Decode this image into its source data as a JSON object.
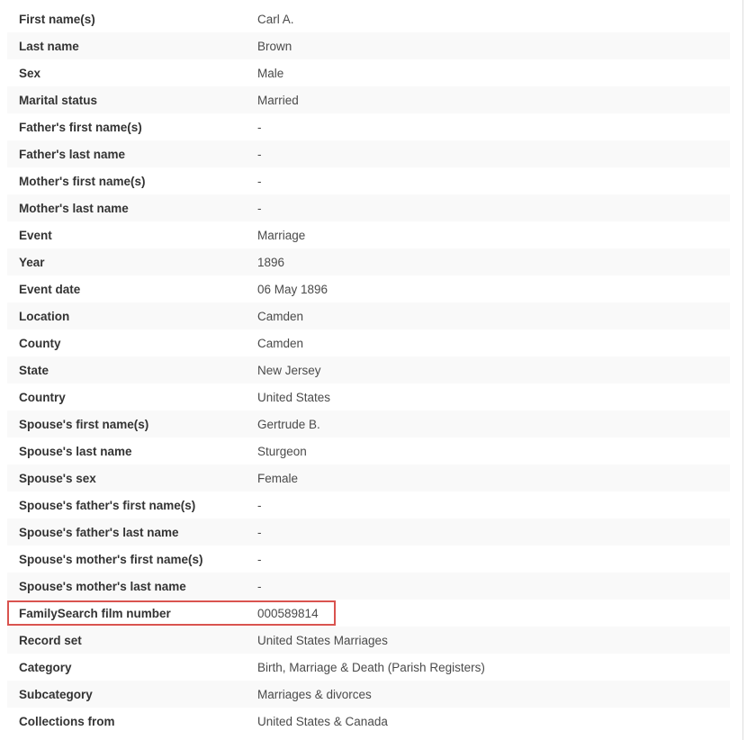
{
  "highlight_color": "#d9534f",
  "highlighted_field": "familysearch_film_number",
  "rows": [
    {
      "label": "First name(s)",
      "value": "Carl A."
    },
    {
      "label": "Last name",
      "value": "Brown"
    },
    {
      "label": "Sex",
      "value": "Male"
    },
    {
      "label": "Marital status",
      "value": "Married"
    },
    {
      "label": "Father's first name(s)",
      "value": "-"
    },
    {
      "label": "Father's last name",
      "value": "-"
    },
    {
      "label": "Mother's first name(s)",
      "value": "-"
    },
    {
      "label": "Mother's last name",
      "value": "-"
    },
    {
      "label": "Event",
      "value": "Marriage"
    },
    {
      "label": "Year",
      "value": "1896"
    },
    {
      "label": "Event date",
      "value": "06 May 1896"
    },
    {
      "label": "Location",
      "value": "Camden"
    },
    {
      "label": "County",
      "value": "Camden"
    },
    {
      "label": "State",
      "value": "New Jersey"
    },
    {
      "label": "Country",
      "value": "United States"
    },
    {
      "label": "Spouse's first name(s)",
      "value": "Gertrude B."
    },
    {
      "label": "Spouse's last name",
      "value": "Sturgeon"
    },
    {
      "label": "Spouse's sex",
      "value": "Female"
    },
    {
      "label": "Spouse's father's first name(s)",
      "value": "-"
    },
    {
      "label": "Spouse's father's last name",
      "value": "-"
    },
    {
      "label": "Spouse's mother's first name(s)",
      "value": "-"
    },
    {
      "label": "Spouse's mother's last name",
      "value": "-"
    },
    {
      "label": "FamilySearch film number",
      "value": "000589814"
    },
    {
      "label": "Record set",
      "value": "United States Marriages"
    },
    {
      "label": "Category",
      "value": "Birth, Marriage & Death (Parish Registers)"
    },
    {
      "label": "Subcategory",
      "value": "Marriages & divorces"
    },
    {
      "label": "Collections from",
      "value": "United States & Canada"
    }
  ]
}
